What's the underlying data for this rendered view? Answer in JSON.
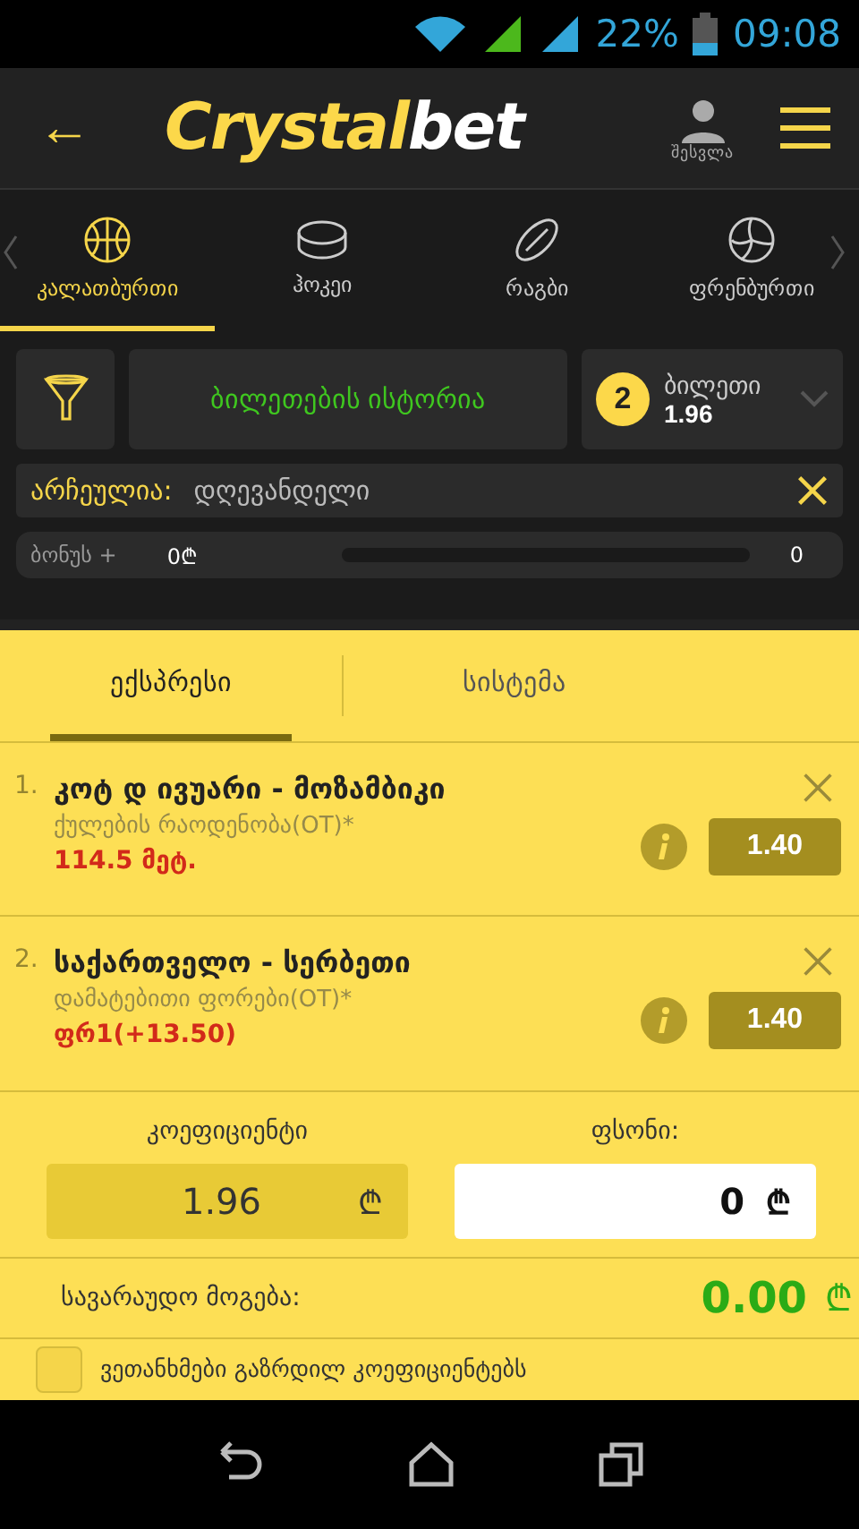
{
  "status_bar": {
    "battery": "22%",
    "time": "09:08"
  },
  "header": {
    "back": "←",
    "logo_main": "Crystal",
    "logo_accent": "bet",
    "login_label": "შესვლა"
  },
  "sport_tabs": [
    {
      "label": "კალათბურთი",
      "selected": true
    },
    {
      "label": "ჰოკეი",
      "selected": false
    },
    {
      "label": "რაგბი",
      "selected": false
    },
    {
      "label": "ფრენბურთი",
      "selected": false
    }
  ],
  "toolbar": {
    "history_button": "ბილეთების ისტორია",
    "ticket_count": "2",
    "ticket_label": "ბილეთი",
    "ticket_odds": "1.96"
  },
  "filter": {
    "label": "არჩეულია:",
    "value": "დღევანდელი"
  },
  "bonus": {
    "label": "ბონუს +",
    "amount": "0₾",
    "level": 0,
    "count": "0"
  },
  "bet_tabs": [
    {
      "label": "ექსპრესი",
      "selected": true
    },
    {
      "label": "სისტემა",
      "selected": false
    }
  ],
  "bets": [
    {
      "number": "1.",
      "match": "კოტ დ ივუარი - მოზამბიკი",
      "market": "ქულების რაოდენობა(OT)*",
      "pick": "114.5 მეტ.",
      "odds": "1.40"
    },
    {
      "number": "2.",
      "match": "საქართველო - სერბეთი",
      "market": "დამატებითი ფორები(OT)*",
      "pick": "ფრ1(+13.50)",
      "odds": "1.40"
    }
  ],
  "summary": {
    "odds_label": "კოეფიციენტი",
    "odds_value": "1.96",
    "stake_label": "ფსონი:",
    "stake_value": "0",
    "currency": "₾",
    "win_label": "სავარაუდო მოგება:",
    "win_value": "0.00"
  },
  "agree": {
    "label": "ვეთანხმები გაზრდილ კოეფიციენტებს",
    "checked": false
  }
}
